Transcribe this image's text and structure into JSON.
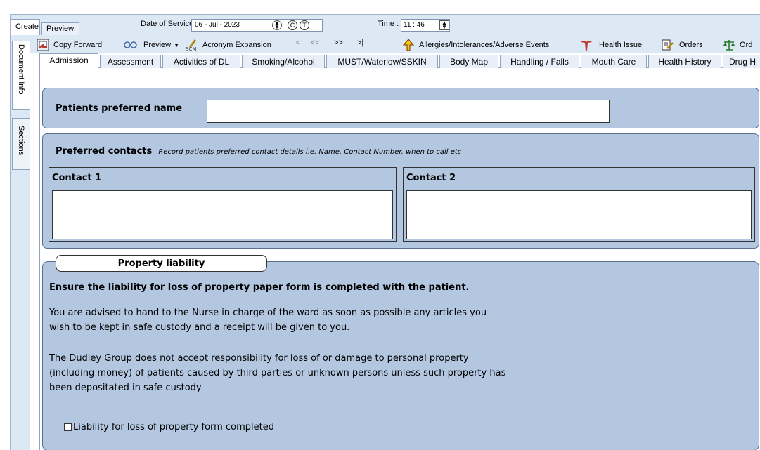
{
  "top_tabs": {
    "create": "Create",
    "preview": "Preview"
  },
  "service": {
    "date_label": "Date of Service :",
    "date_value": "06  -  Jul   -  2023",
    "btn_c": "C",
    "btn_t": "T",
    "time_label": "Time :",
    "time_value": "11  : 46"
  },
  "left_tabs": {
    "document_info": "Document Info",
    "sections": "Sections"
  },
  "toolbar": {
    "copy_forward": "Copy Forward",
    "preview": "Preview",
    "acronym": "Acronym Expansion",
    "nav_first": "|<",
    "nav_prev": "<<",
    "nav_next": ">>",
    "nav_last": ">|",
    "allergies": "Allergies/Intolerances/Adverse Events",
    "health_issue": "Health Issue",
    "orders": "Orders",
    "ord": "Ord"
  },
  "section_tabs": [
    "Admission",
    "Assessment",
    "Activities of DL",
    "Smoking/Alcohol",
    "MUST/Waterlow/SSKIN",
    "Body Map",
    "Handling / Falls",
    "Mouth Care",
    "Health History",
    "Drug H"
  ],
  "form": {
    "preferred_name_label": "Patients preferred name",
    "preferred_name_value": "",
    "contacts_title": "Preferred contacts",
    "contacts_hint": "Record patients preferred contact details i.e. Name, Contact Number, when to call etc",
    "contact1_label": "Contact 1",
    "contact1_value": "",
    "contact2_label": "Contact 2",
    "contact2_value": "",
    "property_title": "Property liability",
    "property_bold": "Ensure the liability for loss of property paper form is completed with the patient.",
    "para1_line1": "You are advised to hand to the Nurse in charge of the ward as soon as possible any articles you",
    "para1_line2": "wish to be kept in safe custody and a receipt will be given to you.",
    "para2_line1": "The Dudley Group does not accept responsibility for loss of or damage to personal property",
    "para2_line2": "(including money) of patients caused by third parties or unknown persons unless such property has",
    "para2_line3": "been depositated in safe custody",
    "checkbox_label": "Liability for loss of property form completed",
    "checkbox_checked": false
  },
  "colors": {
    "panel": "#b4c7e0",
    "chrome": "#dde8f5"
  },
  "icons": [
    "copy-forward-icon",
    "preview-icon",
    "acronym-icon",
    "allergy-arrow-icon",
    "health-issue-icon",
    "orders-icon",
    "scales-icon"
  ]
}
